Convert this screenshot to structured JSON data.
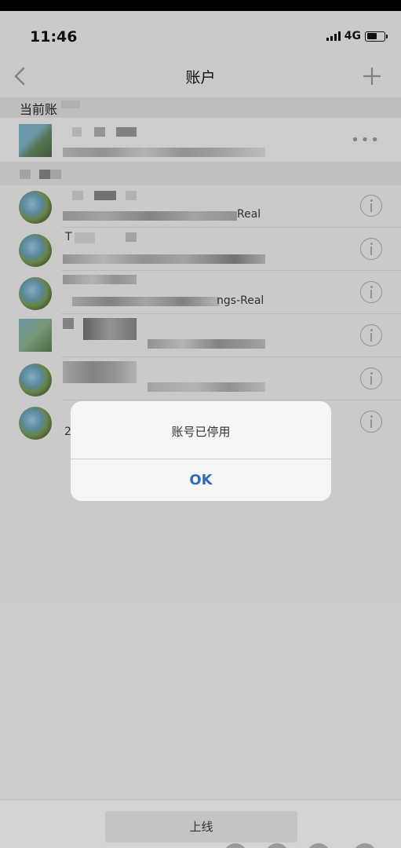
{
  "status_bar": {
    "time": "11:46",
    "network": "4G"
  },
  "nav": {
    "title": "账户"
  },
  "sections": {
    "current": "当前账"
  },
  "accounts": [
    {
      "prefix": "",
      "suffix": "Real"
    },
    {
      "prefix": "T",
      "suffix": ""
    },
    {
      "prefix": "",
      "suffix": "ngs-Real"
    },
    {
      "prefix": "",
      "suffix": ""
    },
    {
      "prefix": "",
      "suffix": ""
    },
    {
      "prefix": "2",
      "suffix": ""
    }
  ],
  "dialog": {
    "message": "账号已停用",
    "ok_label": "OK"
  },
  "bottom": {
    "online_label": "上线"
  },
  "colors": {
    "accent": "#2f6db5",
    "background": "#d3d3d3"
  }
}
